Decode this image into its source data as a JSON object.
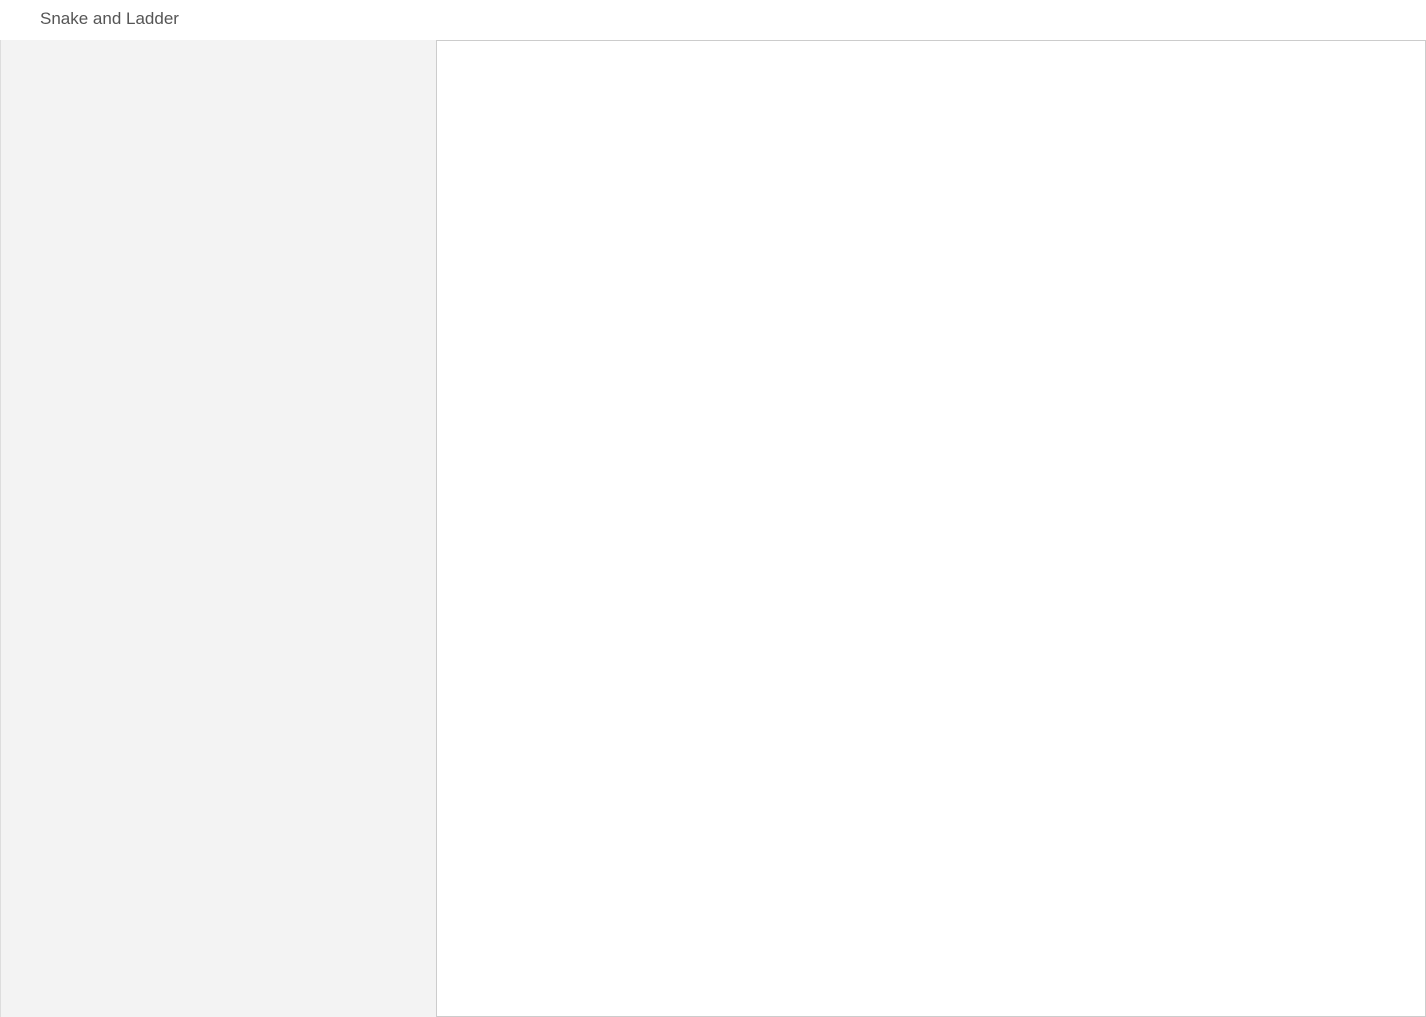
{
  "window": {
    "title": "Snake and Ladder"
  }
}
